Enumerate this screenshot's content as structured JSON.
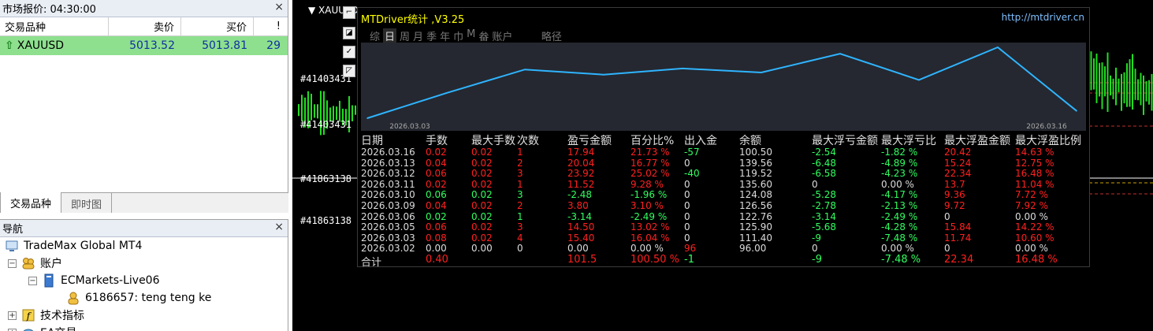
{
  "market_watch": {
    "title": "市场报价: 04:30:00",
    "close_label": "×",
    "headers": {
      "symbol": "交易品种",
      "bid": "卖价",
      "ask": "买价",
      "spread": "!"
    },
    "rows": [
      {
        "symbol": "XAUUSD",
        "bid": "5013.52",
        "ask": "5013.81",
        "spread": "29"
      }
    ],
    "tabs": [
      "交易品种",
      "即时图"
    ]
  },
  "navigator": {
    "title": "导航",
    "close_label": "×",
    "items": [
      {
        "label": "TradeMax Global MT4",
        "toggle": ""
      },
      {
        "label": "账户",
        "toggle": "−"
      },
      {
        "label": "ECMarkets-Live06",
        "toggle": "−"
      },
      {
        "label": "6186657: teng teng ke",
        "toggle": ""
      },
      {
        "label": "技术指标",
        "toggle": "+"
      },
      {
        "label": "EA交易",
        "toggle": "+"
      }
    ]
  },
  "chart": {
    "symbol_title": "XAUUSD",
    "order_labels": [
      "#41403431",
      "#41403431",
      "#41863138",
      "#41863138"
    ],
    "tools": [
      "⌐",
      "◪",
      "✓",
      "◸"
    ]
  },
  "mtdriver": {
    "title": "MTDriver统计 ,V3.25",
    "url": "http://mtdriver.cn",
    "tabs": [
      "综",
      "日",
      "周",
      "月",
      "季",
      "年",
      "巾",
      "M",
      "畚",
      "账户",
      "",
      "",
      "",
      "",
      "略径"
    ],
    "active_tab_index": 1,
    "curve": {
      "start_label": "2026.03.03",
      "end_label": "2026.03.16",
      "balance_values": [
        96.0,
        111.4,
        125.9,
        122.76,
        126.56,
        124.08,
        135.6,
        119.52,
        139.56,
        100.5
      ],
      "note": ""
    },
    "headers": [
      "日期",
      "手数",
      "最大手数",
      "次数",
      "盈亏金额",
      "百分比%",
      "出入金",
      "余额",
      "最大浮亏金额",
      "最大浮亏比",
      "最大浮盈金额",
      "最大浮盈比例"
    ],
    "rows": [
      {
        "date": "2026.03.16",
        "lots": "0.02",
        "max_lots": "0.02",
        "count": "1",
        "pnl": "17.94",
        "pct": "21.73 %",
        "flow": "-57",
        "balance": "100.50",
        "max_dd": "-2.54",
        "max_dd_pct": "-1.82 %",
        "max_fp": "20.42",
        "max_fp_pct": "14.63 %",
        "tone": "r"
      },
      {
        "date": "2026.03.13",
        "lots": "0.04",
        "max_lots": "0.02",
        "count": "2",
        "pnl": "20.04",
        "pct": "16.77 %",
        "flow": "0",
        "balance": "139.56",
        "max_dd": "-6.48",
        "max_dd_pct": "-4.89 %",
        "max_fp": "15.24",
        "max_fp_pct": "12.75 %",
        "tone": "r"
      },
      {
        "date": "2026.03.12",
        "lots": "0.06",
        "max_lots": "0.02",
        "count": "3",
        "pnl": "23.92",
        "pct": "25.02 %",
        "flow": "-40",
        "balance": "119.52",
        "max_dd": "-6.58",
        "max_dd_pct": "-4.23 %",
        "max_fp": "22.34",
        "max_fp_pct": "16.48 %",
        "tone": "r"
      },
      {
        "date": "2026.03.11",
        "lots": "0.02",
        "max_lots": "0.02",
        "count": "1",
        "pnl": "11.52",
        "pct": "9.28 %",
        "flow": "0",
        "balance": "135.60",
        "max_dd": "0",
        "max_dd_pct": "0.00 %",
        "max_fp": "13.7",
        "max_fp_pct": "11.04 %",
        "tone": "r"
      },
      {
        "date": "2026.03.10",
        "lots": "0.06",
        "max_lots": "0.02",
        "count": "3",
        "pnl": "-2.48",
        "pct": "-1.96 %",
        "flow": "0",
        "balance": "124.08",
        "max_dd": "-5.28",
        "max_dd_pct": "-4.17 %",
        "max_fp": "9.36",
        "max_fp_pct": "7.72 %",
        "tone": "g"
      },
      {
        "date": "2026.03.09",
        "lots": "0.04",
        "max_lots": "0.02",
        "count": "2",
        "pnl": "3.80",
        "pct": "3.10 %",
        "flow": "0",
        "balance": "126.56",
        "max_dd": "-2.78",
        "max_dd_pct": "-2.13 %",
        "max_fp": "9.72",
        "max_fp_pct": "7.92 %",
        "tone": "r"
      },
      {
        "date": "2026.03.06",
        "lots": "0.02",
        "max_lots": "0.02",
        "count": "1",
        "pnl": "-3.14",
        "pct": "-2.49 %",
        "flow": "0",
        "balance": "122.76",
        "max_dd": "-3.14",
        "max_dd_pct": "-2.49 %",
        "max_fp": "0",
        "max_fp_pct": "0.00 %",
        "tone": "g"
      },
      {
        "date": "2026.03.05",
        "lots": "0.06",
        "max_lots": "0.02",
        "count": "3",
        "pnl": "14.50",
        "pct": "13.02 %",
        "flow": "0",
        "balance": "125.90",
        "max_dd": "-5.68",
        "max_dd_pct": "-4.28 %",
        "max_fp": "15.84",
        "max_fp_pct": "14.22 %",
        "tone": "r"
      },
      {
        "date": "2026.03.03",
        "lots": "0.08",
        "max_lots": "0.02",
        "count": "4",
        "pnl": "15.40",
        "pct": "16.04 %",
        "flow": "0",
        "balance": "111.40",
        "max_dd": "-9",
        "max_dd_pct": "-7.48 %",
        "max_fp": "11.74",
        "max_fp_pct": "10.60 %",
        "tone": "r"
      },
      {
        "date": "2026.03.02",
        "lots": "0.00",
        "max_lots": "0.00",
        "count": "0",
        "pnl": "0.00",
        "pct": "0.00 %",
        "flow": "96",
        "balance": "96.00",
        "max_dd": "0",
        "max_dd_pct": "0.00 %",
        "max_fp": "0",
        "max_fp_pct": "0.00 %",
        "tone": "w"
      }
    ],
    "total": {
      "date": "合计",
      "lots": "0.40",
      "pnl": "101.5",
      "pct": "100.50 %",
      "flow": "-1",
      "max_dd": "-9",
      "max_dd_pct": "-7.48 %",
      "max_fp": "22.34",
      "max_fp_pct": "16.48 %"
    }
  },
  "colors": {
    "positive": "#ff2020",
    "negative": "#30ff60",
    "curve": "#2fb4ff",
    "accent_row": "#8ee08e"
  }
}
